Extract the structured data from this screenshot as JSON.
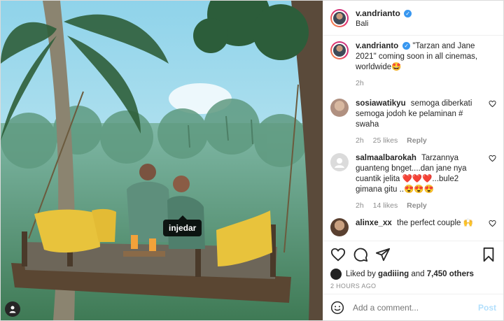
{
  "header": {
    "username": "v.andrianto",
    "location": "Bali"
  },
  "photo": {
    "tag_label": "injedar"
  },
  "caption": {
    "username": "v.andrianto",
    "text": "\"Tarzan and Jane 2021\" coming soon in all cinemas, worldwide🤩",
    "time": "2h"
  },
  "comments": [
    {
      "username": "sosiawatikyu",
      "text": "semoga diberkati semoga jodoh ke pelaminan # swaha",
      "time": "2h",
      "likes": "25 likes",
      "reply": "Reply"
    },
    {
      "username": "salmaalbarokah",
      "text": "Tarzannya guanteng bnget....dan jane nya cuantik jelita ❤️❤️❤️...bule2 gimana gitu ..😍😍😍",
      "time": "2h",
      "likes": "14 likes",
      "reply": "Reply"
    },
    {
      "username": "alinxe_xx",
      "text": "the perfect couple 🙌",
      "time": "",
      "likes": "",
      "reply": ""
    }
  ],
  "likes": {
    "prefix": "Liked by",
    "user": "gadiiing",
    "joiner": "and",
    "others": "7,450 others"
  },
  "timestamp": "2 HOURS AGO",
  "add_comment": {
    "placeholder": "Add a comment...",
    "post_label": "Post"
  },
  "colors": {
    "verified": "#3897f0",
    "post_disabled": "#b2dffc"
  },
  "icons": [
    "heart-icon",
    "comment-icon",
    "share-icon",
    "bookmark-icon",
    "emoji-icon",
    "user-tag-icon",
    "verified-icon"
  ]
}
